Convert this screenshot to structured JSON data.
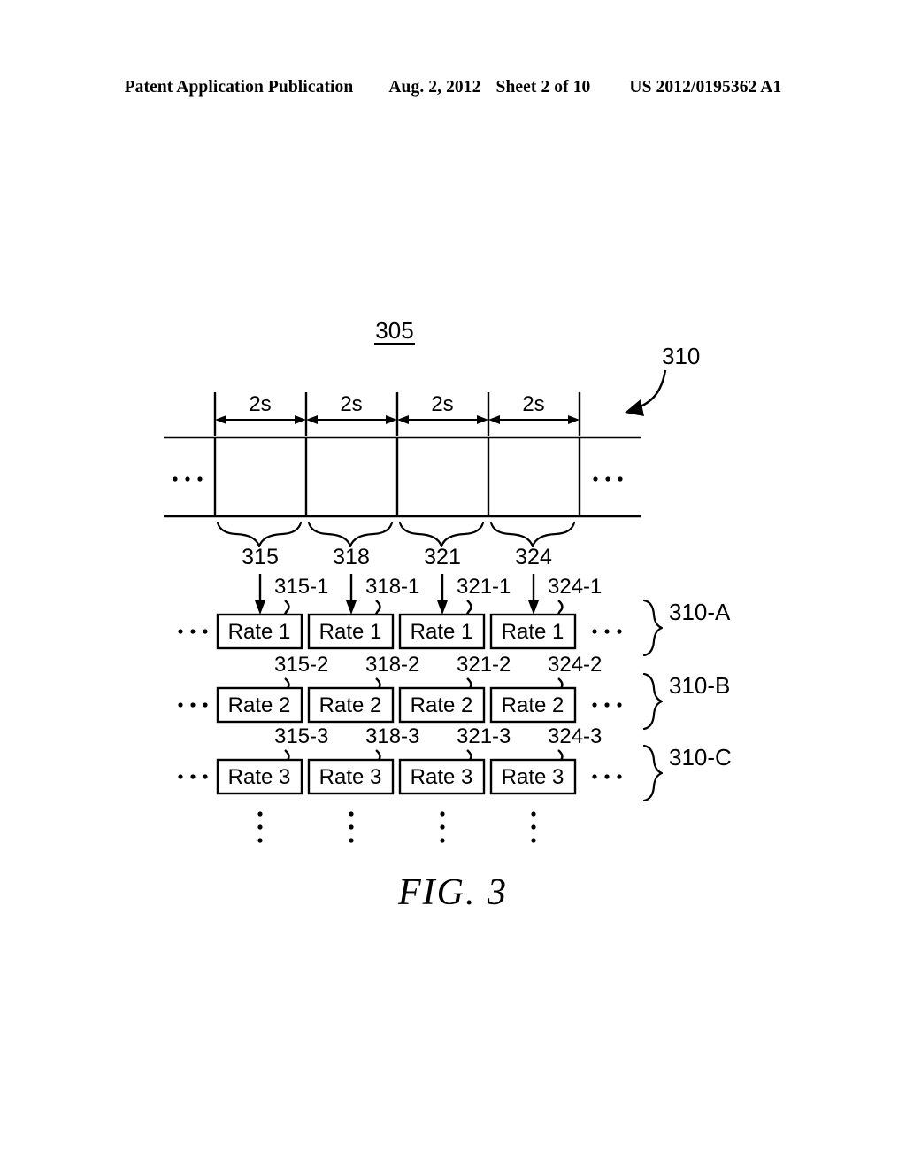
{
  "header": {
    "publication": "Patent Application Publication",
    "date": "Aug. 2, 2012",
    "sheet": "Sheet 2 of 10",
    "patent_number": "US 2012/0195362 A1"
  },
  "figure": {
    "caption": "FIG. 3",
    "stream_label": "305",
    "group_label": "310",
    "interval_label": "2s",
    "ellipsis_horizontal": "• • •",
    "segments": [
      {
        "id": "315",
        "sub": [
          "315-1",
          "315-2",
          "315-3"
        ]
      },
      {
        "id": "318",
        "sub": [
          "318-1",
          "318-2",
          "318-3"
        ]
      },
      {
        "id": "321",
        "sub": [
          "321-1",
          "321-2",
          "321-3"
        ]
      },
      {
        "id": "324",
        "sub": [
          "324-1",
          "324-2",
          "324-3"
        ]
      }
    ],
    "rows": [
      {
        "group": "310-A",
        "box_label": "Rate 1"
      },
      {
        "group": "310-B",
        "box_label": "Rate 2"
      },
      {
        "group": "310-C",
        "box_label": "Rate 3"
      }
    ],
    "interval_count": 4
  }
}
